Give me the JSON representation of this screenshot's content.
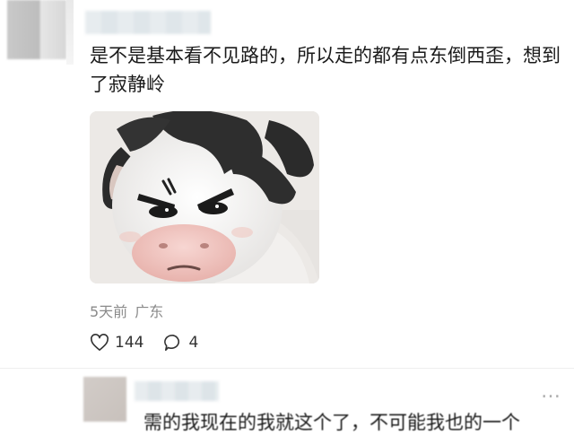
{
  "comment": {
    "text": "是不是基本看不见路的，所以走的都有点东倒西歪，想到了寂静岭",
    "time": "5天前",
    "location": "广东",
    "likes": "144",
    "replies": "4",
    "sticker_icon": "angry-cow-sticker"
  },
  "next_comment": {
    "text_partial": "需的我现在的我就这个了，不可能我也的一个"
  },
  "colors": {
    "text": "#1a1a1a",
    "meta": "#8a8a8a",
    "icon": "#333333"
  }
}
